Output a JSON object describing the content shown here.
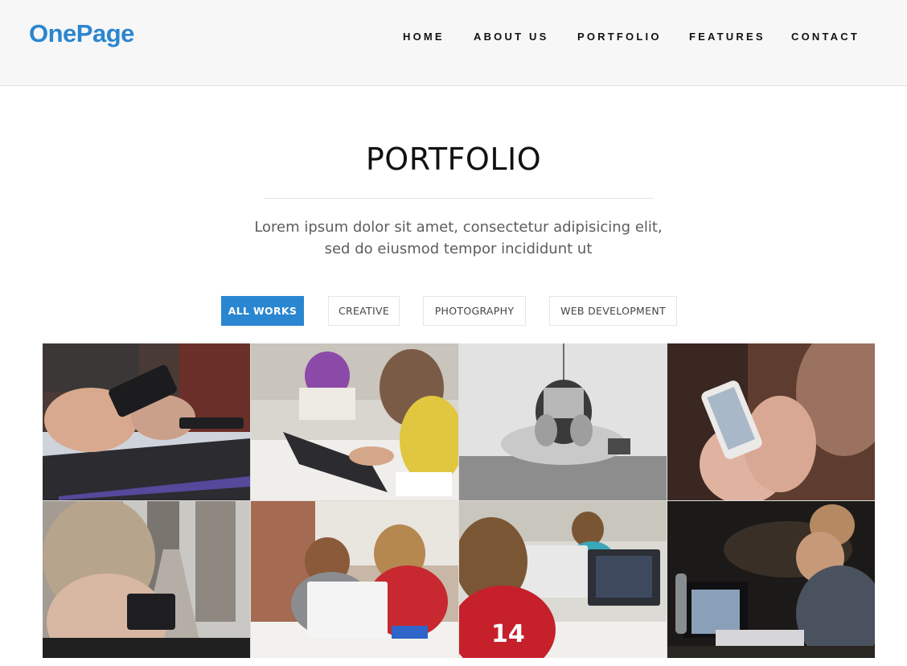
{
  "brand": {
    "logo": "OnePage",
    "accent": "#2a86d0"
  },
  "nav": {
    "items": [
      {
        "label": "HOME"
      },
      {
        "label": "ABOUT US"
      },
      {
        "label": "PORTFOLIO"
      },
      {
        "label": "FEATURES"
      },
      {
        "label": "CONTACT"
      }
    ]
  },
  "portfolio": {
    "title": "PORTFOLIO",
    "description": "Lorem ipsum dolor sit amet, consectetur adipisicing elit, sed do eiusmod tempor incididunt ut",
    "filters": [
      {
        "label": "ALL WORKS",
        "active": true
      },
      {
        "label": "CREATIVE",
        "active": false
      },
      {
        "label": "PHOTOGRAPHY",
        "active": false
      },
      {
        "label": "WEB DEVELOPMENT",
        "active": false
      }
    ],
    "items": [
      {
        "subject": "hands-holding-phone-over-laptop"
      },
      {
        "subject": "student-drawing-on-tablet"
      },
      {
        "subject": "person-with-laptop-on-beanbag"
      },
      {
        "subject": "hands-holding-smartphone"
      },
      {
        "subject": "woman-photographing-city-street"
      },
      {
        "subject": "children-at-laptop"
      },
      {
        "subject": "boy-coding-on-laptop"
      },
      {
        "subject": "man-working-on-laptop-at-night"
      }
    ]
  }
}
